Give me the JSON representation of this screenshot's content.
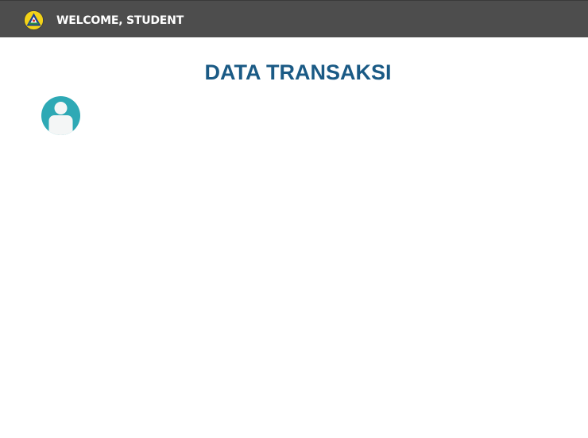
{
  "header": {
    "logo_icon": "app-logo-icon",
    "welcome_text": "WELCOME, STUDENT",
    "background_color": "#4d4d4d"
  },
  "main": {
    "title": "DATA TRANSAKSI",
    "title_color": "#1a5a85",
    "avatar_icon": "user-avatar-icon",
    "avatar_color": "#2ea9b5"
  }
}
